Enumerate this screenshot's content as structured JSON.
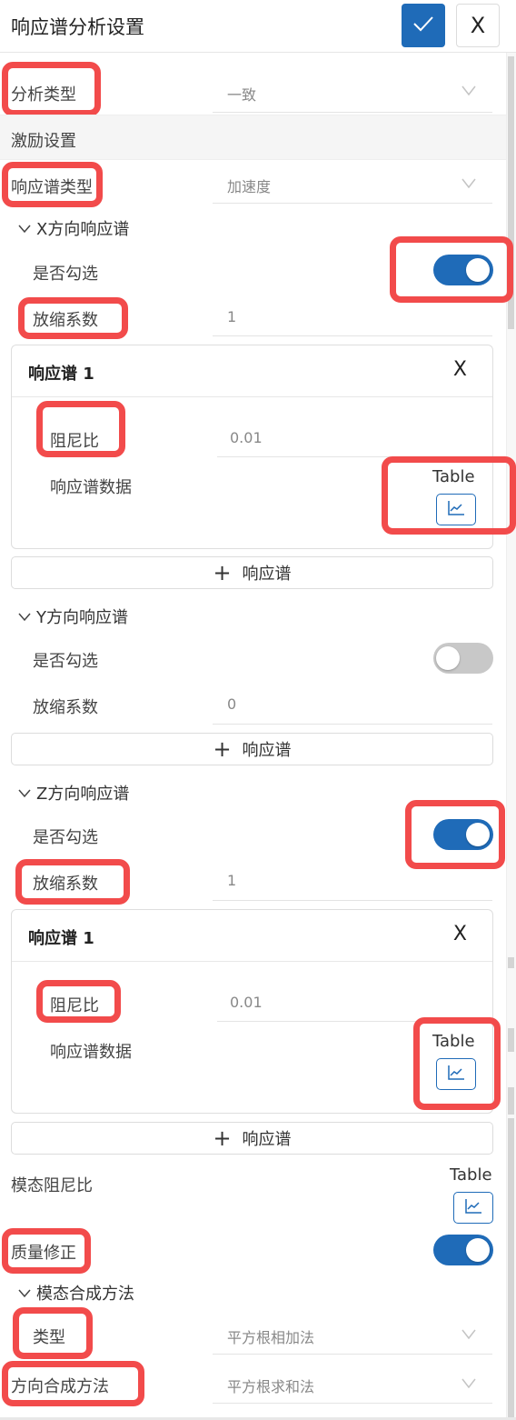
{
  "header": {
    "title": "响应谱分析设置",
    "confirm_icon": "check-icon",
    "close_label": "X"
  },
  "analysis_type": {
    "label": "分析类型",
    "value": "一致"
  },
  "excitation_section": {
    "label": "激励设置"
  },
  "spectrum_type": {
    "label": "响应谱类型",
    "value": "加速度"
  },
  "x_dir": {
    "heading": "X方向响应谱",
    "checked_label": "是否勾选",
    "checked": true,
    "scale_label": "放缩系数",
    "scale_value": "1",
    "card": {
      "title": "响应谱 1",
      "close_label": "X",
      "damping_label": "阻尼比",
      "damping_value": "0.01",
      "data_label": "响应谱数据",
      "table_label": "Table",
      "chart_icon": "line-chart-icon"
    },
    "add_label": "响应谱"
  },
  "y_dir": {
    "heading": "Y方向响应谱",
    "checked_label": "是否勾选",
    "checked": false,
    "scale_label": "放缩系数",
    "scale_value": "0",
    "add_label": "响应谱"
  },
  "z_dir": {
    "heading": "Z方向响应谱",
    "checked_label": "是否勾选",
    "checked": true,
    "scale_label": "放缩系数",
    "scale_value": "1",
    "card": {
      "title": "响应谱 1",
      "close_label": "X",
      "damping_label": "阻尼比",
      "damping_value": "0.01",
      "data_label": "响应谱数据",
      "table_label": "Table",
      "chart_icon": "line-chart-icon"
    },
    "add_label": "响应谱"
  },
  "modal_damping": {
    "label": "模态阻尼比",
    "table_label": "Table",
    "chart_icon": "line-chart-icon"
  },
  "mass_correction": {
    "label": "质量修正",
    "checked": true
  },
  "modal_combination": {
    "heading": "模态合成方法",
    "type_label": "类型",
    "type_value": "平方根相加法",
    "direction_label": "方向合成方法",
    "direction_value": "平方根求和法"
  },
  "colors": {
    "accent": "#1f6bb8",
    "highlight": "#f24b4b",
    "toggle_off": "#c8c8c8"
  }
}
